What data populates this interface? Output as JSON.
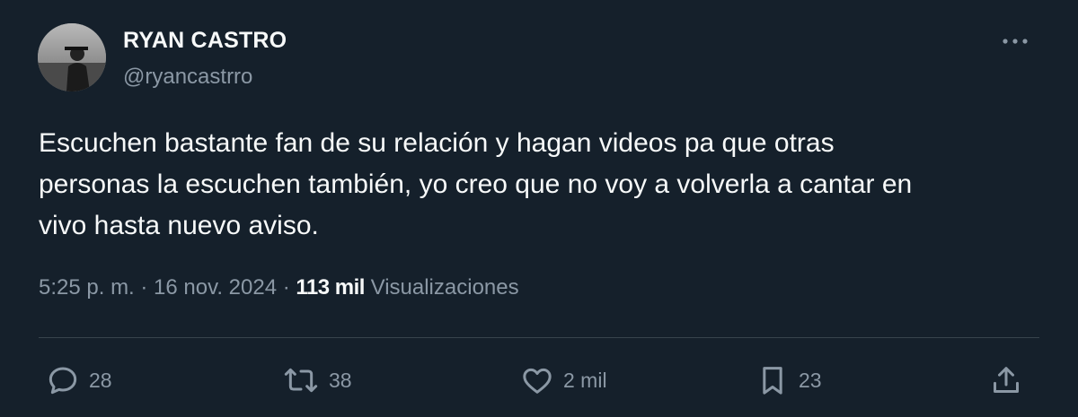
{
  "tweet": {
    "author_name": "RYAN CASTRO",
    "author_handle": "@ryancastrro",
    "text": "Escuchen bastante fan de su relación y hagan videos pa que otras\npersonas la escuchen también, yo creo que no voy a volverla a cantar en\nvivo hasta nuevo aviso.",
    "timestamp": "5:25 p. m. · 16 nov. 2024 · ",
    "views_count": "113 mil",
    "views_label": " Visualizaciones"
  },
  "actions": {
    "replies": "28",
    "reposts": "38",
    "likes": "2 mil",
    "bookmarks": "23"
  },
  "icons": {
    "more": "more-horizontal-icon",
    "reply": "reply-icon",
    "repost": "repost-icon",
    "like": "heart-icon",
    "bookmark": "bookmark-icon",
    "share": "share-icon"
  },
  "colors": {
    "background": "#15202b",
    "text_primary": "#f7f9f9",
    "text_secondary": "#8b98a5",
    "divider": "#38444d"
  }
}
